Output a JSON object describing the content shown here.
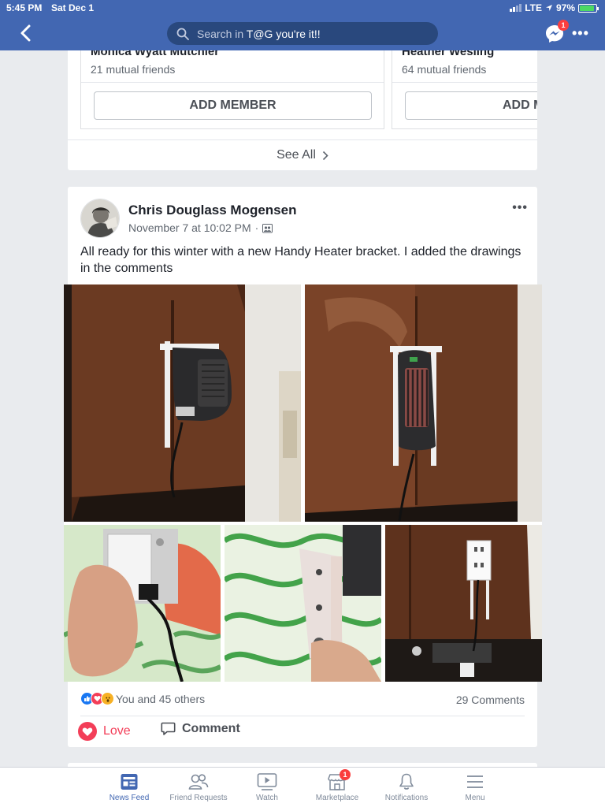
{
  "status_bar": {
    "time": "5:45 PM",
    "date": "Sat Dec 1",
    "network": "LTE",
    "battery": "97%"
  },
  "header": {
    "search_prefix": "Search in ",
    "search_group": "T@G you're it!!",
    "messenger_badge": "1"
  },
  "suggested_members": [
    {
      "name": "Monica Wyatt Mutchler",
      "mutual": "21 mutual friends",
      "button": "ADD MEMBER"
    },
    {
      "name": "Heather Wesling",
      "mutual": "64 mutual friends",
      "button": "ADD M"
    }
  ],
  "see_all": "See All",
  "post": {
    "author": "Chris Douglass Mogensen",
    "timestamp": "November 7 at 10:02 PM",
    "separator": "·",
    "text": "All ready for this winter with a new Handy Heater bracket.  I added the drawings in the comments",
    "photos": [
      {
        "subject": "heater-on-bracket-side-view"
      },
      {
        "subject": "heater-on-bracket-front-view"
      },
      {
        "subject": "hand-holding-outlet-box"
      },
      {
        "subject": "hand-holding-bracket"
      },
      {
        "subject": "outlet-on-bracket"
      }
    ],
    "reactions_text": "You and 45 others",
    "reaction_types": [
      "like",
      "love",
      "wow"
    ],
    "comments_count": "29 Comments",
    "love_label": "Love",
    "comment_label": "Comment"
  },
  "tabs": [
    {
      "label": "News Feed",
      "icon": "news-feed-icon",
      "active": true
    },
    {
      "label": "Friend Requests",
      "icon": "friend-requests-icon"
    },
    {
      "label": "Watch",
      "icon": "watch-icon"
    },
    {
      "label": "Marketplace",
      "icon": "marketplace-icon",
      "badge": "1"
    },
    {
      "label": "Notifications",
      "icon": "notifications-icon"
    },
    {
      "label": "Menu",
      "icon": "menu-icon"
    }
  ],
  "colors": {
    "brand": "#4267b2",
    "love": "#f33e58",
    "background": "#e9ebee"
  }
}
